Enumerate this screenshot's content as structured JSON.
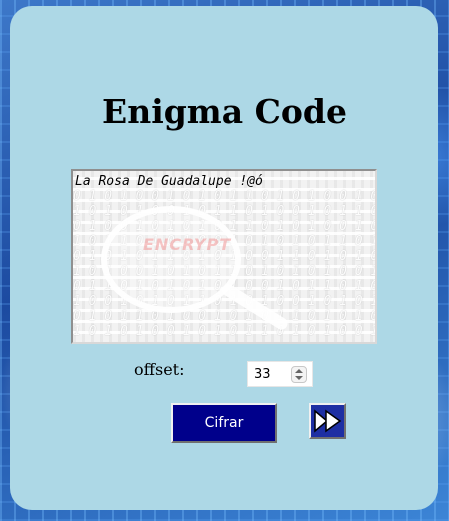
{
  "window": {
    "title": "Enigma Code"
  },
  "editor": {
    "text": "La Rosa De Guadalupe !@ó",
    "background_label": "ENCRYPT"
  },
  "offset": {
    "label": "offset:",
    "value": "33"
  },
  "actions": {
    "cifrar_label": "Cifrar",
    "next_icon": "fast-forward-icon"
  },
  "colors": {
    "panel": "#add8e6",
    "button": "#00008b",
    "title": "#000000"
  }
}
